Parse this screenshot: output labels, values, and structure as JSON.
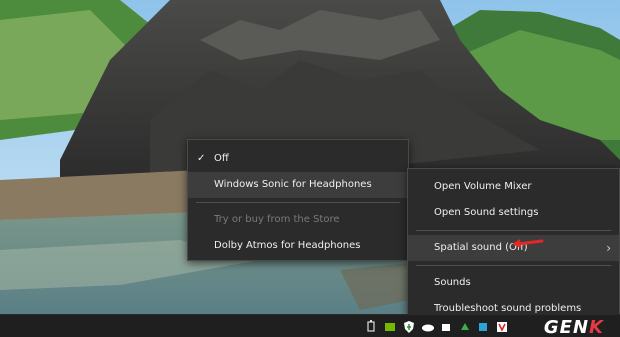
{
  "spatial_submenu": {
    "items": [
      {
        "label": "Off",
        "checked": true
      },
      {
        "label": "Windows Sonic for Headphones"
      },
      {
        "label": "Try or buy from the Store",
        "disabled": true
      },
      {
        "label": "Dolby Atmos for Headphones"
      }
    ]
  },
  "context_menu": {
    "items": [
      {
        "label": "Open Volume Mixer"
      },
      {
        "label": "Open Sound settings"
      },
      {
        "label": "Spatial sound (Off)"
      },
      {
        "label": "Sounds"
      },
      {
        "label": "Troubleshoot sound problems"
      }
    ]
  },
  "icons": {
    "check": "checkmark-icon",
    "submenu": "chevron-right-icon",
    "annotation": "red-arrow-icon"
  },
  "watermark": {
    "text_main": "GEN",
    "text_accent": "K"
  },
  "colors": {
    "menu_bg": "#2b2b2b",
    "menu_hover": "#3d3d3d",
    "menu_text": "#f0f0f0",
    "disabled_text": "#7a7a7a",
    "annotation_red": "#e32626"
  }
}
